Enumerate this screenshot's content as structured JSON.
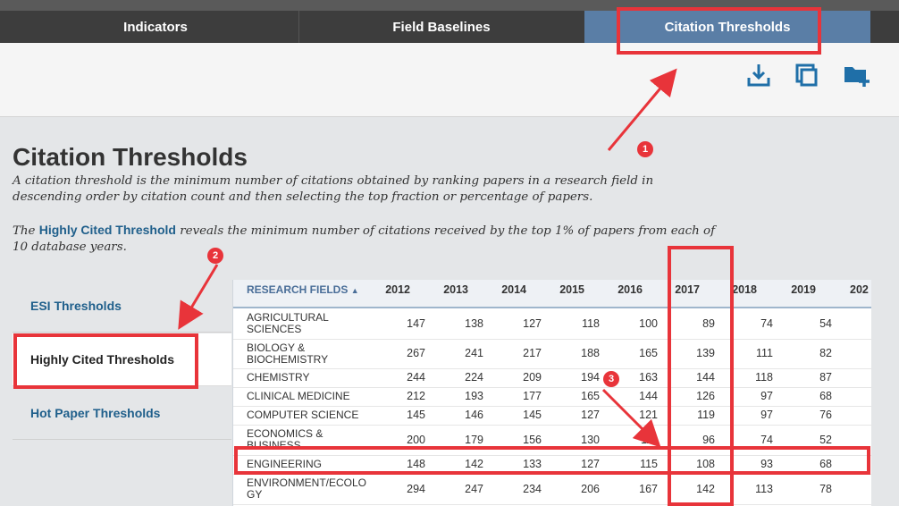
{
  "nav": {
    "tabs": [
      {
        "label": "Indicators"
      },
      {
        "label": "Field Baselines"
      },
      {
        "label": "Citation Thresholds"
      }
    ]
  },
  "toolbar": {
    "icons": [
      "download-icon",
      "print-icon",
      "add-folder-icon"
    ],
    "accent": "#1f6fa8"
  },
  "page": {
    "title": "Citation Thresholds",
    "desc1_line1": "A citation threshold is the minimum number of citations obtained by ranking papers in a research field in",
    "desc1_line2": "descending order by citation count and then selecting the top fraction or percentage of papers.",
    "desc2_prefix": "The ",
    "desc2_highlight": "Highly Cited Threshold",
    "desc2_rest": " reveals the minimum number of citations received by the top 1% of papers from each of",
    "desc2_line2": "10 database years."
  },
  "sidebar": {
    "items": [
      {
        "label": "ESI Thresholds"
      },
      {
        "label": "Highly Cited Thresholds"
      },
      {
        "label": "Hot Paper Thresholds"
      }
    ]
  },
  "table": {
    "header_field": "RESEARCH FIELDS",
    "sort_icon": "sort-up-icon",
    "years": [
      "2012",
      "2013",
      "2014",
      "2015",
      "2016",
      "2017",
      "2018",
      "2019",
      "202"
    ],
    "rows": [
      {
        "name_l1": "AGRICULTURAL",
        "name_l2": "SCIENCES",
        "values": [
          "147",
          "138",
          "127",
          "118",
          "100",
          "89",
          "74",
          "54"
        ]
      },
      {
        "name_l1": "BIOLOGY &",
        "name_l2": "BIOCHEMISTRY",
        "values": [
          "267",
          "241",
          "217",
          "188",
          "165",
          "139",
          "111",
          "82"
        ]
      },
      {
        "name_l1": "CHEMISTRY",
        "name_l2": "",
        "values": [
          "244",
          "224",
          "209",
          "194",
          "163",
          "144",
          "118",
          "87"
        ]
      },
      {
        "name_l1": "CLINICAL MEDICINE",
        "name_l2": "",
        "values": [
          "212",
          "193",
          "177",
          "165",
          "144",
          "126",
          "97",
          "68"
        ]
      },
      {
        "name_l1": "COMPUTER SCIENCE",
        "name_l2": "",
        "values": [
          "145",
          "146",
          "145",
          "127",
          "121",
          "119",
          "97",
          "76"
        ]
      },
      {
        "name_l1": "ECONOMICS &",
        "name_l2": "BUSINESS",
        "values": [
          "200",
          "179",
          "156",
          "130",
          "111",
          "96",
          "74",
          "52"
        ]
      },
      {
        "name_l1": "ENGINEERING",
        "name_l2": "",
        "values": [
          "148",
          "142",
          "133",
          "127",
          "115",
          "108",
          "93",
          "68"
        ]
      },
      {
        "name_l1": "ENVIRONMENT/ECOLO",
        "name_l2": "GY",
        "values": [
          "294",
          "247",
          "234",
          "206",
          "167",
          "142",
          "113",
          "78"
        ]
      }
    ]
  },
  "annotations": {
    "badges": [
      "1",
      "2",
      "3"
    ],
    "color": "#e8343a"
  }
}
